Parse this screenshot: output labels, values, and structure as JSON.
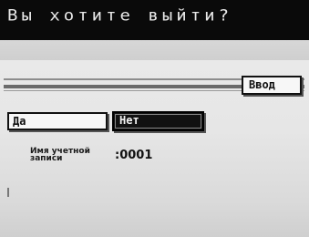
{
  "dialog": {
    "title": "Вы хотите выйти?",
    "enter_label": "Ввод",
    "yes_label": "Да",
    "no_label": "Нет",
    "account_label": "Имя учетной записи",
    "account_value": ":0001"
  }
}
